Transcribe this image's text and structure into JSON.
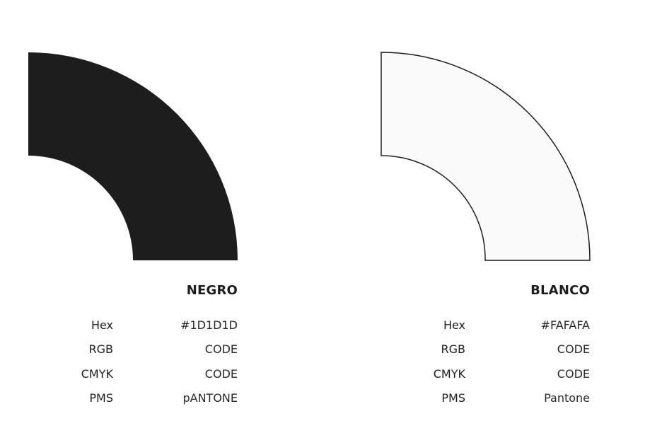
{
  "swatches": [
    {
      "name": "NEGRO",
      "color": "#1D1D1D",
      "outline": "none",
      "specs": [
        {
          "label": "Hex",
          "value": "#1D1D1D"
        },
        {
          "label": "RGB",
          "value": "CODE"
        },
        {
          "label": "CMYK",
          "value": "CODE"
        },
        {
          "label": "PMS",
          "value": "pANTONE"
        }
      ]
    },
    {
      "name": "BLANCO",
      "color": "#FAFAFA",
      "outline": "#1D1D1D",
      "specs": [
        {
          "label": "Hex",
          "value": "#FAFAFA"
        },
        {
          "label": "RGB",
          "value": "CODE"
        },
        {
          "label": "CMYK",
          "value": "CODE"
        },
        {
          "label": "PMS",
          "value": "Pantone"
        }
      ]
    }
  ]
}
